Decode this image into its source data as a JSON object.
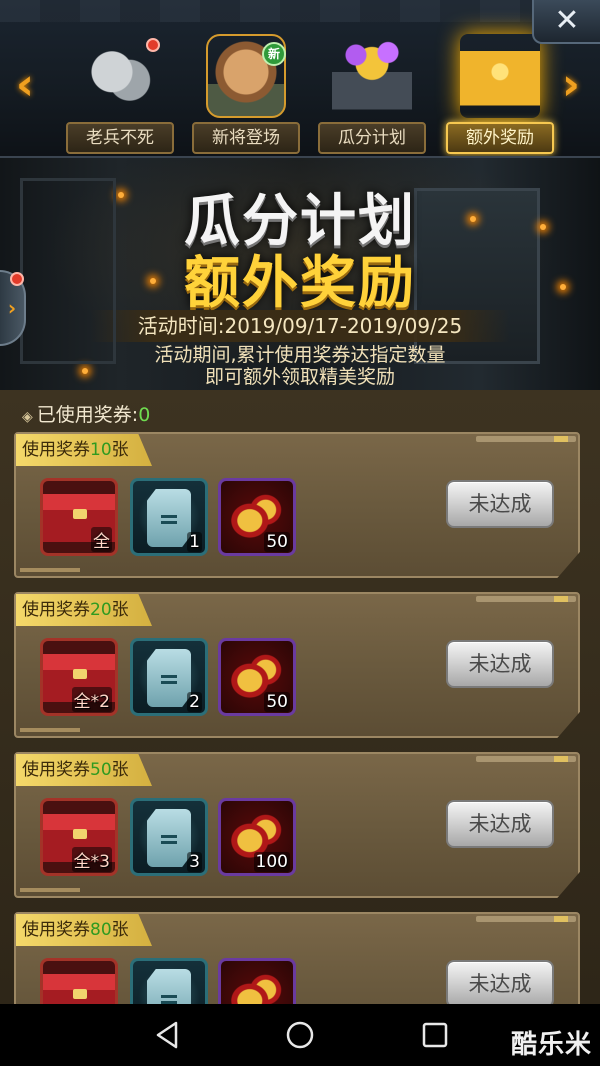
{
  "topbar": {
    "tabs": [
      {
        "label": "老兵不死"
      },
      {
        "label": "新将登场",
        "badge": "新"
      },
      {
        "label": "瓜分计划"
      },
      {
        "label": "额外奖励"
      }
    ],
    "close_label": "✕",
    "prev_label": "‹",
    "next_label": "›"
  },
  "banner": {
    "title_line1": "瓜分计划",
    "title_line2": "额外奖励",
    "time": "活动时间:2019/09/17-2019/09/25",
    "desc_line1": "活动期间,累计使用奖券达指定数量",
    "desc_line2": "即可额外领取精美奖励"
  },
  "used": {
    "label": "已使用奖券:",
    "value": "0"
  },
  "tiers": [
    {
      "header_prefix": "使用奖券",
      "count": "10",
      "header_suffix": "张",
      "chest_qty": "全",
      "exp_qty": "1",
      "coin_qty": "50",
      "button": "未达成"
    },
    {
      "header_prefix": "使用奖券",
      "count": "20",
      "header_suffix": "张",
      "chest_qty": "全*2",
      "exp_qty": "2",
      "coin_qty": "50",
      "button": "未达成"
    },
    {
      "header_prefix": "使用奖券",
      "count": "50",
      "header_suffix": "张",
      "chest_qty": "全*3",
      "exp_qty": "3",
      "coin_qty": "100",
      "button": "未达成"
    },
    {
      "header_prefix": "使用奖券",
      "count": "80",
      "header_suffix": "张",
      "button": "未达成"
    }
  ],
  "watermark": "酷乐米",
  "colors": {
    "accent_gold": "#ffd23a",
    "highlight_green": "#6fdc50",
    "panel_brown": "#6a5a3e"
  }
}
